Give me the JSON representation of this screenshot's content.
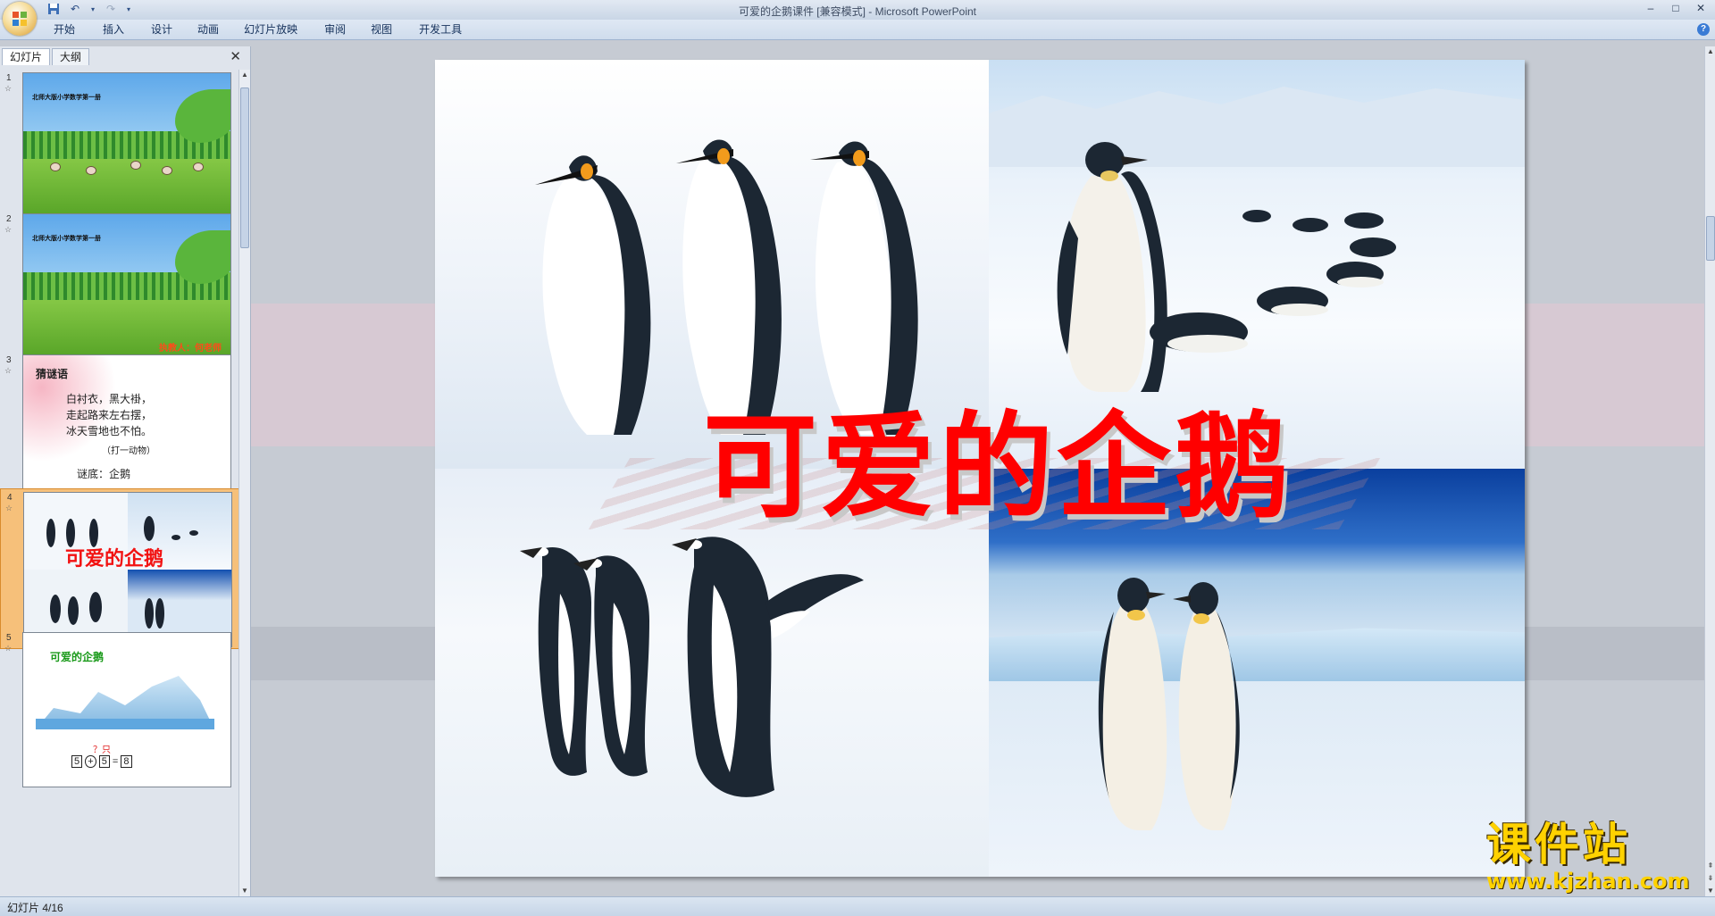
{
  "app": {
    "window_title": "可爱的企鹅课件 [兼容模式] - Microsoft PowerPoint",
    "ribbon_tabs": [
      "开始",
      "插入",
      "设计",
      "动画",
      "幻灯片放映",
      "审阅",
      "视图",
      "开发工具"
    ],
    "window_controls": [
      "–",
      "□",
      "✕"
    ]
  },
  "left_panel": {
    "tabs": [
      "幻灯片",
      "大纲"
    ],
    "close_glyph": "✕",
    "thumbnails": [
      {
        "num": "1",
        "title": "北师大版小学数学第一册"
      },
      {
        "num": "2",
        "title": "北师大版小学数学第一册",
        "author": "执教人：何老师"
      },
      {
        "num": "3",
        "title": "猜谜语",
        "lines": [
          "白衬衣，黑大褂，",
          "走起路来左右摆，",
          "冰天雪地也不怕。"
        ],
        "hint": "（打一动物）",
        "answer": "谜底：企鹅"
      },
      {
        "num": "4",
        "title": "可爱的企鹅"
      },
      {
        "num": "5",
        "title": "可爱的企鹅",
        "question": "？只",
        "equation": [
          "5",
          "+",
          "5",
          "=",
          "8"
        ]
      }
    ],
    "selected_index": 4
  },
  "slide": {
    "title": "可爱的企鹅"
  },
  "status": {
    "slide_indicator": "幻灯片 4/16"
  },
  "watermark": {
    "logo": "课件站",
    "url": "www.kjzhan.com"
  },
  "colors": {
    "title_red": "#ff0000",
    "selected_thumb": "#f6c07a",
    "ribbon_text": "#15315b"
  }
}
